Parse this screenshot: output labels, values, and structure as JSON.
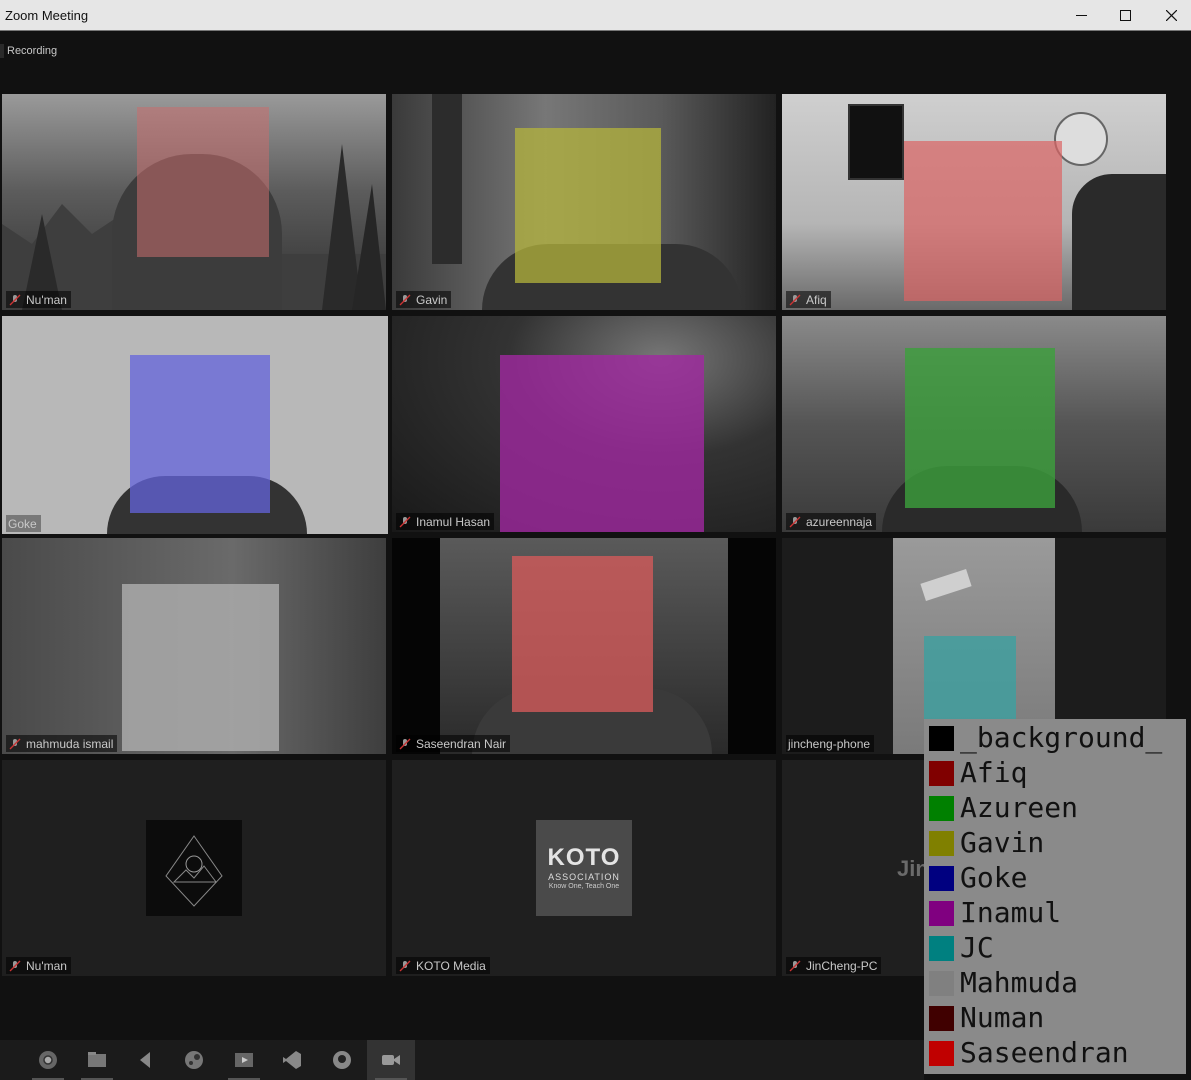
{
  "window": {
    "title": "Zoom Meeting",
    "recording_label": "Recording"
  },
  "tiles": [
    {
      "name": "Nu'man"
    },
    {
      "name": "Gavin"
    },
    {
      "name": "Afiq"
    },
    {
      "name": "Goke"
    },
    {
      "name": "Inamul Hasan"
    },
    {
      "name": "azureennaja"
    },
    {
      "name": "mahmuda ismail"
    },
    {
      "name": "Saseendran Nair"
    },
    {
      "name": "jincheng-phone"
    },
    {
      "name": "Nu'man"
    },
    {
      "name": "KOTO Media"
    },
    {
      "name": "JinCheng-PC"
    }
  ],
  "koto_logo": {
    "word": "KOTO",
    "subtitle": "ASSOCIATION",
    "tagline": "Know One, Teach One"
  },
  "jincheng_pc_overlay": "JinCheng-PC",
  "legend": {
    "items": [
      {
        "label": "_background_",
        "color": "#000000"
      },
      {
        "label": "Afiq",
        "color": "#800000"
      },
      {
        "label": "Azureen",
        "color": "#008000"
      },
      {
        "label": "Gavin",
        "color": "#808000"
      },
      {
        "label": "Goke",
        "color": "#000080"
      },
      {
        "label": "Inamul",
        "color": "#800080"
      },
      {
        "label": "JC",
        "color": "#008080"
      },
      {
        "label": "Mahmuda",
        "color": "#808080"
      },
      {
        "label": "Numan",
        "color": "#400000"
      },
      {
        "label": "Saseendran",
        "color": "#c00000"
      }
    ]
  },
  "taskbar": {
    "icons": [
      "windows-start-icon",
      "chrome-icon",
      "file-explorer-icon",
      "media-player-icon",
      "steam-icon",
      "video-editor-icon",
      "vscode-icon",
      "github-icon",
      "zoom-icon"
    ]
  }
}
